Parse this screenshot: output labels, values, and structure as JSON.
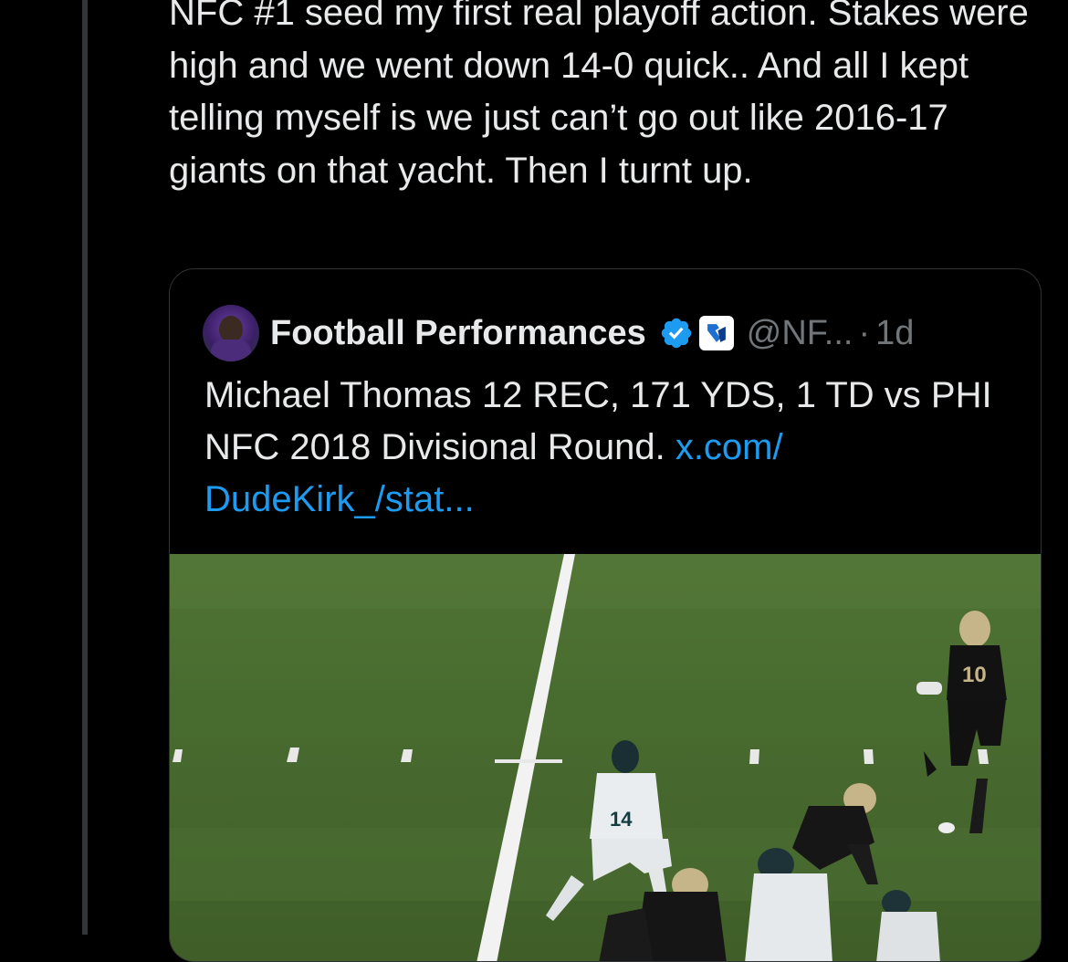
{
  "tweet": {
    "text": "NFC #1 seed my first real playoff action. Stakes were high and we went down 14-0 quick.. And all I kept telling myself is we just can’t go out like 2016-17 giants on that yacht. Then I turnt up."
  },
  "quote": {
    "display_name": "Football Performances",
    "handle": "@NF...",
    "separator": "·",
    "timestamp": "1d",
    "text": "Michael Thomas 12 REC, 171 YDS, 1 TD vs PHI NFC 2018 Divisional Round. ",
    "link": "x.com/\nDudeKirk_/stat...",
    "verified_icon": "verified-badge-icon",
    "affiliate_icon": "affiliate-badge-icon",
    "media": {
      "jersey_numbers": [
        "10",
        "14"
      ]
    }
  },
  "colors": {
    "background": "#000000",
    "text": "#e7e9ea",
    "secondary_text": "#71767b",
    "link": "#1d9bf0",
    "border": "#2f3336",
    "thread_line": "#333639",
    "field_green": "#4a6a2f"
  }
}
